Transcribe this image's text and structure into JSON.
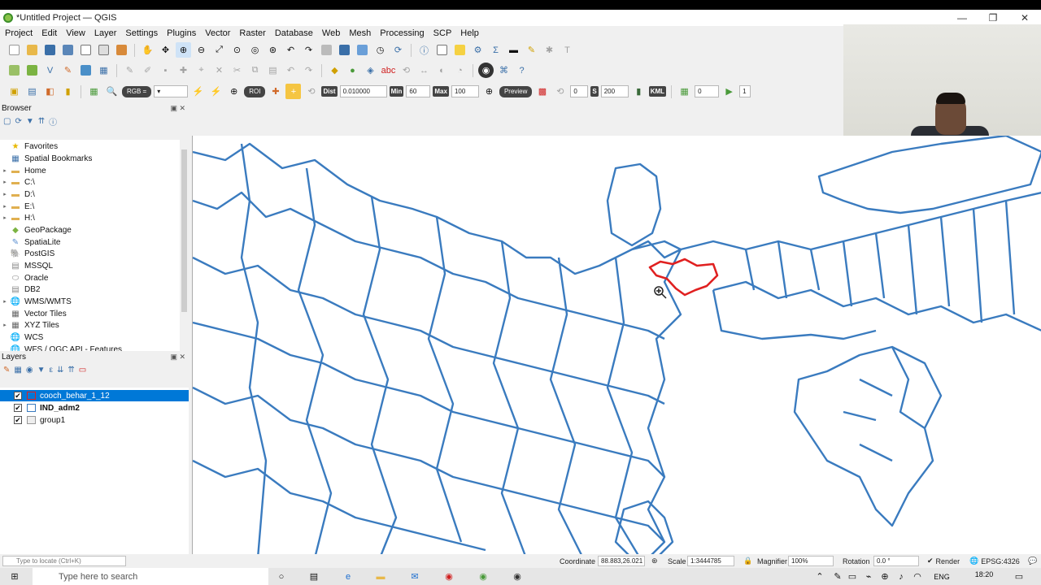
{
  "window": {
    "title": "*Untitled Project — QGIS",
    "minimize": "—",
    "maximize": "❐",
    "close": "✕"
  },
  "menu": [
    "Project",
    "Edit",
    "View",
    "Layer",
    "Settings",
    "Plugins",
    "Vector",
    "Raster",
    "Database",
    "Web",
    "Mesh",
    "Processing",
    "SCP",
    "Help"
  ],
  "scp_toolbar": {
    "rgb_label": "RGB =",
    "roi_label": "ROI",
    "dist_label": "Dist",
    "dist_value": "0.010000",
    "min_label": "Min",
    "min_value": "60",
    "max_label": "Max",
    "max_value": "100",
    "preview_label": "Preview",
    "field_a": "0",
    "s_label": "S",
    "s_value": "200",
    "kml_label": "KML",
    "field_b": "0",
    "field_c": "1"
  },
  "browser": {
    "title": "Browser",
    "items": [
      {
        "label": "Favorites",
        "icon": "star-icon",
        "color": "#e8b800",
        "arrow": ""
      },
      {
        "label": "Spatial Bookmarks",
        "icon": "bookmark-icon",
        "color": "#3a6fa8",
        "arrow": ""
      },
      {
        "label": "Home",
        "icon": "folder-icon",
        "color": "#e0b050",
        "arrow": "▸"
      },
      {
        "label": "C:\\",
        "icon": "folder-icon",
        "color": "#e0b050",
        "arrow": "▸"
      },
      {
        "label": "D:\\",
        "icon": "folder-icon",
        "color": "#e0b050",
        "arrow": "▸"
      },
      {
        "label": "E:\\",
        "icon": "folder-icon",
        "color": "#e0b050",
        "arrow": "▸"
      },
      {
        "label": "H:\\",
        "icon": "folder-icon",
        "color": "#e0b050",
        "arrow": "▸"
      },
      {
        "label": "GeoPackage",
        "icon": "geopackage-icon",
        "color": "#7bb342",
        "arrow": ""
      },
      {
        "label": "SpatiaLite",
        "icon": "spatialite-icon",
        "color": "#5a8fd0",
        "arrow": ""
      },
      {
        "label": "PostGIS",
        "icon": "postgis-icon",
        "color": "#336791",
        "arrow": ""
      },
      {
        "label": "MSSQL",
        "icon": "mssql-icon",
        "color": "#888888",
        "arrow": ""
      },
      {
        "label": "Oracle",
        "icon": "oracle-icon",
        "color": "#888888",
        "arrow": ""
      },
      {
        "label": "DB2",
        "icon": "db2-icon",
        "color": "#888888",
        "arrow": ""
      },
      {
        "label": "WMS/WMTS",
        "icon": "globe-icon",
        "color": "#3a6fa8",
        "arrow": "▸"
      },
      {
        "label": "Vector Tiles",
        "icon": "grid-icon",
        "color": "#666666",
        "arrow": ""
      },
      {
        "label": "XYZ Tiles",
        "icon": "grid-icon",
        "color": "#666666",
        "arrow": "▸"
      },
      {
        "label": "WCS",
        "icon": "globe-icon",
        "color": "#3a6fa8",
        "arrow": ""
      },
      {
        "label": "WFS / OGC API - Features",
        "icon": "globe-icon",
        "color": "#3a6fa8",
        "arrow": ""
      }
    ]
  },
  "layers": {
    "title": "Layers",
    "items": [
      {
        "label": "cooch_behar_1_12",
        "checked": "✔",
        "symbol_color": "#e02020",
        "selected": true
      },
      {
        "label": "IND_adm2",
        "checked": "✔",
        "symbol_color": "#3a7bbf",
        "selected": false
      },
      {
        "label": "group1",
        "checked": "✔",
        "symbol_color": "#999999",
        "selected": false
      }
    ]
  },
  "status": {
    "locate_placeholder": "Type to locate (Ctrl+K)",
    "coordinate_label": "Coordinate",
    "coordinate_value": "88.883,26.021",
    "scale_label": "Scale",
    "scale_value": "1:3444785",
    "magnifier_label": "Magnifier",
    "magnifier_value": "100%",
    "rotation_label": "Rotation",
    "rotation_value": "0.0 °",
    "render_label": "Render",
    "crs_label": "EPSG:4326"
  },
  "taskbar": {
    "search_placeholder": "Type here to search",
    "lang": "ENG",
    "time": "18:20"
  },
  "colors": {
    "boundary": "#3a7bbf",
    "highlight": "#e02020",
    "selection": "#0078d7"
  }
}
